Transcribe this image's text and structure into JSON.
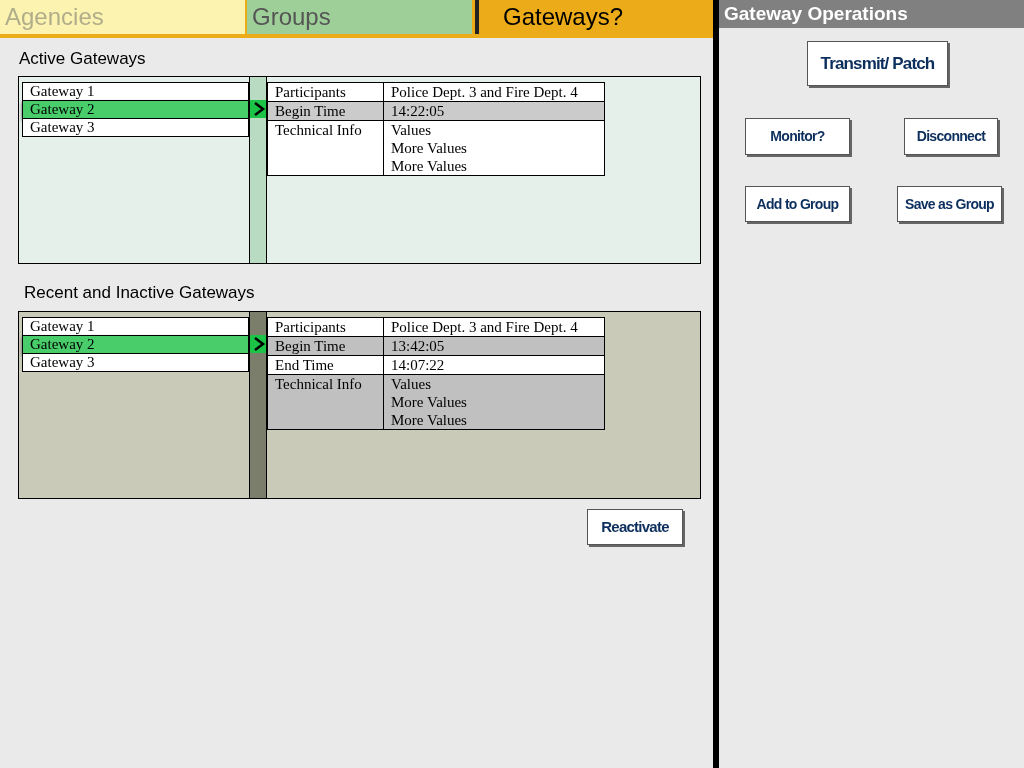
{
  "tabs": [
    {
      "label": "Agencies",
      "selected": false
    },
    {
      "label": "Groups",
      "selected": false
    },
    {
      "label": "Gateways?",
      "selected": true
    }
  ],
  "sections": [
    {
      "title": "Active Gateways",
      "kind": "active",
      "gateways": [
        {
          "label": "Gateway 1",
          "selected": false
        },
        {
          "label": "Gateway 2",
          "selected": true
        },
        {
          "label": "Gateway 3",
          "selected": false
        }
      ],
      "details": [
        {
          "label": "Participants",
          "values": [
            "Police Dept. 3 and Fire Dept. 4"
          ],
          "shaded": false
        },
        {
          "label": "Begin Time",
          "values": [
            "14:22:05"
          ],
          "shaded": true
        },
        {
          "label": "Technical Info",
          "values": [
            "Values",
            "More Values",
            "More Values"
          ],
          "shaded": false
        }
      ]
    },
    {
      "title": "Recent and Inactive Gateways",
      "kind": "inactive",
      "gateways": [
        {
          "label": "Gateway 1",
          "selected": false
        },
        {
          "label": "Gateway 2",
          "selected": true
        },
        {
          "label": "Gateway 3",
          "selected": false
        }
      ],
      "details": [
        {
          "label": "Participants",
          "values": [
            "Police Dept. 3 and Fire Dept. 4"
          ],
          "shaded": false
        },
        {
          "label": "Begin Time",
          "values": [
            "13:42:05"
          ],
          "shaded": true
        },
        {
          "label": "End Time",
          "values": [
            "14:07:22"
          ],
          "shaded": false
        },
        {
          "label": "Technical Info",
          "values": [
            "Values",
            "More Values",
            "More Values"
          ],
          "shaded": true
        }
      ]
    }
  ],
  "reactivate_button": "Reactivate",
  "operations": {
    "title": "Gateway Operations",
    "buttons": [
      [
        "Transmit/ Patch"
      ],
      [
        "Monitor?",
        "Disconnect"
      ],
      [
        "Add to Group",
        "Save as Group"
      ]
    ]
  }
}
